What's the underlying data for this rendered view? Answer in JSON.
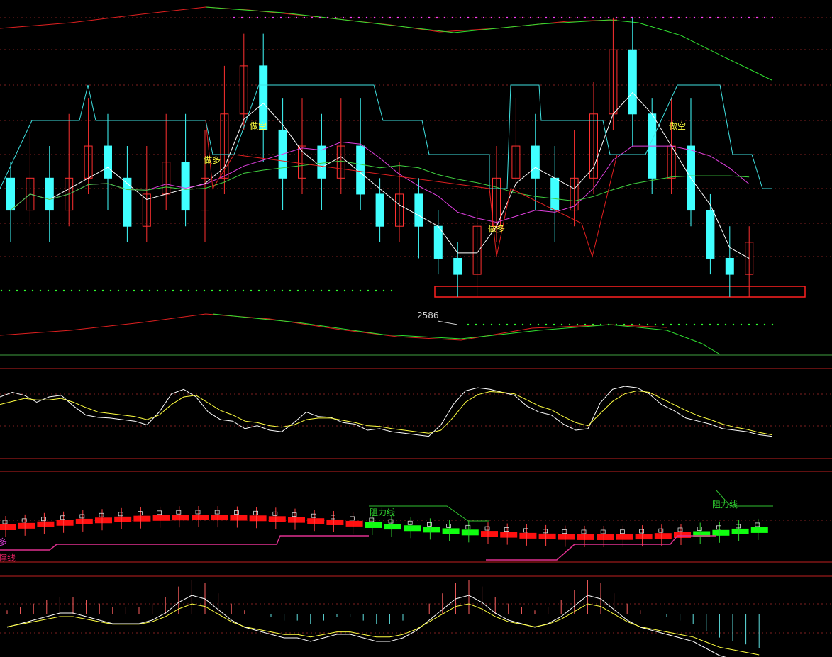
{
  "colors": {
    "background": "#000000",
    "up": "#ff3030",
    "down": "#40ffff",
    "grid": "#802020",
    "separator": "#c02020",
    "ma_white": "#ffffff",
    "ma_magenta": "#e040e0",
    "ma_green": "#40d040",
    "ma_cyan": "#40e0e0",
    "band_red": "#e02020",
    "band_green": "#30e030",
    "yellow": "#ffff40",
    "dot_green": "#30ff30",
    "dot_magenta": "#ff40ff",
    "bull_block": "#ff1010",
    "bear_block": "#10ff10"
  },
  "main_panel": {
    "price_label": "2586",
    "annotations": [
      {
        "text": "做空",
        "bar": 13
      },
      {
        "text": "做多",
        "bar": 10
      },
      {
        "text": "做多",
        "bar": 26
      },
      {
        "text": "做空",
        "bar": 35
      }
    ]
  },
  "signal_panel": {
    "resistance_label_1": "阻力线",
    "resistance_label_2": "阻力线",
    "left_label_1": "多",
    "left_label_2": "撑线"
  },
  "chart_data": [
    {
      "type": "candlestick",
      "panel": "main",
      "y_levels": [
        2620,
        2605,
        2595,
        2590,
        2580,
        2575
      ],
      "bars": [
        {
          "o": 2605,
          "c": 2595,
          "h": 2610,
          "l": 2585
        },
        {
          "o": 2595,
          "c": 2605,
          "h": 2620,
          "l": 2590
        },
        {
          "o": 2605,
          "c": 2595,
          "h": 2615,
          "l": 2585
        },
        {
          "o": 2595,
          "c": 2605,
          "h": 2625,
          "l": 2590
        },
        {
          "o": 2605,
          "c": 2615,
          "h": 2630,
          "l": 2600
        },
        {
          "o": 2615,
          "c": 2605,
          "h": 2625,
          "l": 2595
        },
        {
          "o": 2605,
          "c": 2590,
          "h": 2615,
          "l": 2585
        },
        {
          "o": 2590,
          "c": 2600,
          "h": 2615,
          "l": 2585
        },
        {
          "o": 2600,
          "c": 2610,
          "h": 2625,
          "l": 2595
        },
        {
          "o": 2610,
          "c": 2595,
          "h": 2625,
          "l": 2590
        },
        {
          "o": 2595,
          "c": 2605,
          "h": 2620,
          "l": 2585
        },
        {
          "o": 2605,
          "c": 2625,
          "h": 2640,
          "l": 2600
        },
        {
          "o": 2625,
          "c": 2640,
          "h": 2650,
          "l": 2620
        },
        {
          "o": 2640,
          "c": 2620,
          "h": 2650,
          "l": 2610
        },
        {
          "o": 2620,
          "c": 2605,
          "h": 2630,
          "l": 2595
        },
        {
          "o": 2605,
          "c": 2615,
          "h": 2630,
          "l": 2600
        },
        {
          "o": 2615,
          "c": 2605,
          "h": 2625,
          "l": 2595
        },
        {
          "o": 2605,
          "c": 2615,
          "h": 2630,
          "l": 2600
        },
        {
          "o": 2615,
          "c": 2600,
          "h": 2630,
          "l": 2595
        },
        {
          "o": 2600,
          "c": 2590,
          "h": 2605,
          "l": 2585
        },
        {
          "o": 2590,
          "c": 2600,
          "h": 2610,
          "l": 2585
        },
        {
          "o": 2600,
          "c": 2590,
          "h": 2605,
          "l": 2580
        },
        {
          "o": 2590,
          "c": 2580,
          "h": 2595,
          "l": 2575
        },
        {
          "o": 2580,
          "c": 2575,
          "h": 2585,
          "l": 2568
        },
        {
          "o": 2575,
          "c": 2590,
          "h": 2595,
          "l": 2568
        },
        {
          "o": 2590,
          "c": 2605,
          "h": 2615,
          "l": 2585
        },
        {
          "o": 2605,
          "c": 2615,
          "h": 2630,
          "l": 2600
        },
        {
          "o": 2615,
          "c": 2605,
          "h": 2625,
          "l": 2595
        },
        {
          "o": 2605,
          "c": 2595,
          "h": 2615,
          "l": 2585
        },
        {
          "o": 2595,
          "c": 2605,
          "h": 2620,
          "l": 2590
        },
        {
          "o": 2605,
          "c": 2625,
          "h": 2635,
          "l": 2600
        },
        {
          "o": 2625,
          "c": 2645,
          "h": 2655,
          "l": 2620
        },
        {
          "o": 2645,
          "c": 2625,
          "h": 2655,
          "l": 2615
        },
        {
          "o": 2625,
          "c": 2605,
          "h": 2630,
          "l": 2600
        },
        {
          "o": 2605,
          "c": 2615,
          "h": 2630,
          "l": 2600
        },
        {
          "o": 2615,
          "c": 2595,
          "h": 2630,
          "l": 2590
        },
        {
          "o": 2595,
          "c": 2580,
          "h": 2600,
          "l": 2575
        },
        {
          "o": 2580,
          "c": 2575,
          "h": 2590,
          "l": 2568
        },
        {
          "o": 2575,
          "c": 2585,
          "h": 2590,
          "l": 2568
        }
      ]
    },
    {
      "type": "line",
      "panel": "kdj",
      "series": [
        {
          "name": "",
          "values": [
            72,
            78,
            74,
            65,
            72,
            74,
            60,
            48,
            45,
            44,
            42,
            40,
            35,
            52,
            76,
            82,
            72,
            52,
            42,
            40,
            30,
            34,
            28,
            26,
            38,
            52,
            46,
            45,
            38,
            36,
            28,
            30,
            26,
            24,
            22,
            20,
            35,
            62,
            80,
            84,
            82,
            78,
            74,
            60,
            52,
            48,
            36,
            28,
            30,
            64,
            82,
            86,
            84,
            76,
            62,
            54,
            44,
            40,
            36,
            30,
            28,
            26,
            22,
            20
          ]
        },
        {
          "name": "",
          "values": [
            62,
            66,
            70,
            68,
            68,
            70,
            65,
            58,
            52,
            50,
            48,
            46,
            42,
            48,
            62,
            72,
            74,
            64,
            54,
            48,
            40,
            38,
            34,
            32,
            35,
            42,
            44,
            44,
            41,
            38,
            34,
            33,
            30,
            28,
            26,
            24,
            28,
            45,
            65,
            75,
            79,
            78,
            76,
            68,
            60,
            55,
            46,
            38,
            34,
            50,
            66,
            76,
            80,
            78,
            70,
            62,
            54,
            47,
            42,
            36,
            32,
            29,
            25,
            22
          ]
        }
      ]
    },
    {
      "type": "bar",
      "panel": "macd",
      "values": [
        1,
        2,
        3,
        4,
        5,
        5,
        4,
        3,
        2,
        2,
        2,
        3,
        5,
        8,
        10,
        9,
        6,
        3,
        1,
        0,
        -1,
        -2,
        -2,
        -3,
        -2,
        -1,
        -1,
        -2,
        -3,
        -3,
        -2,
        0,
        3,
        6,
        9,
        10,
        8,
        5,
        3,
        2,
        1,
        2,
        4,
        7,
        10,
        9,
        6,
        3,
        1,
        0,
        -1,
        -2,
        -3,
        -5,
        -7,
        -8,
        -9,
        -10
      ]
    }
  ]
}
